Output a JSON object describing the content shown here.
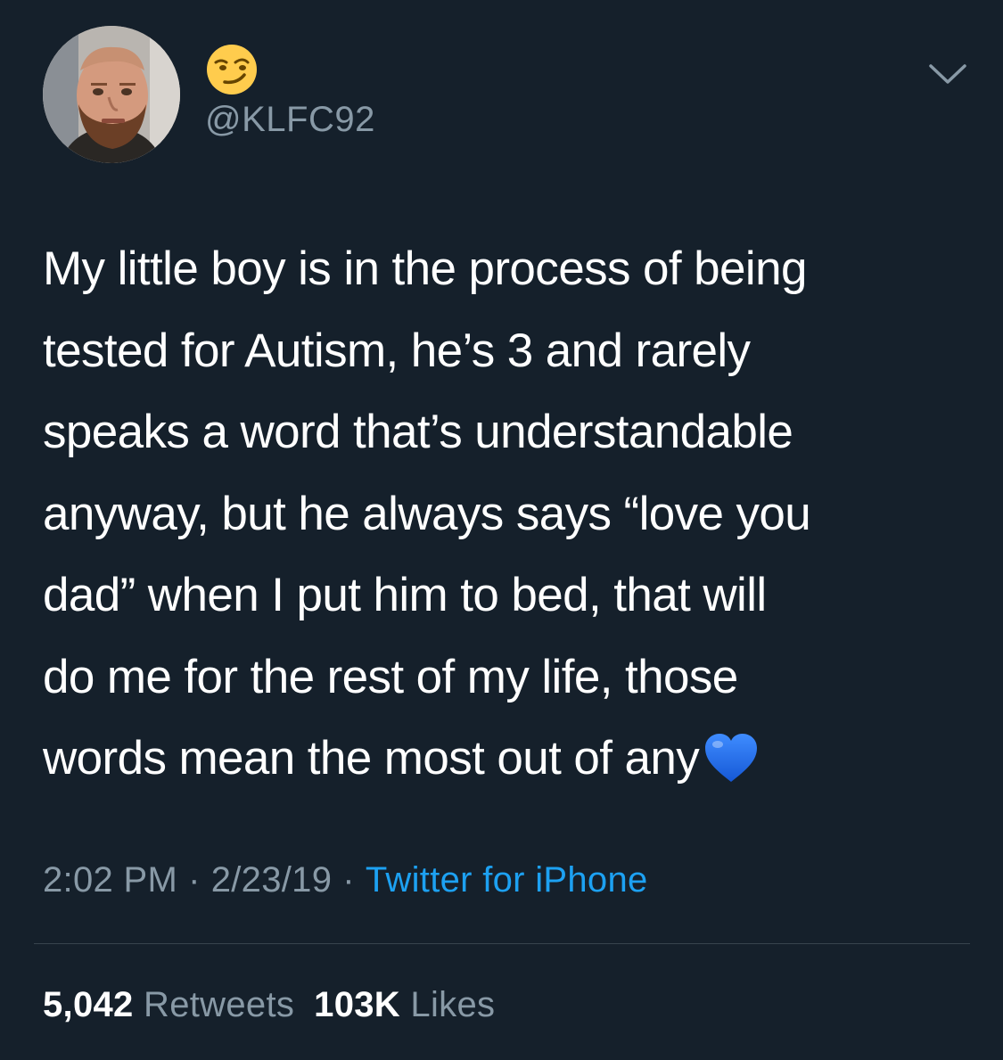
{
  "user": {
    "avatar_icon": "profile-photo-man-with-beard",
    "display_name_icon": "smirking-face-emoji",
    "handle": "@KLFC92"
  },
  "tweet": {
    "lines": [
      "My little boy is in the process of being",
      "tested for Autism, he’s 3 and rarely",
      "speaks a word that’s understandable",
      "anyway, but he always says “love you",
      "dad” when I put him to bed, that will",
      "do me for the rest of my life, those",
      "words mean the most out of any"
    ],
    "trailing_emoji": "blue-heart-emoji"
  },
  "meta": {
    "time": "2:02 PM",
    "separator": "·",
    "date": "2/23/19",
    "source": "Twitter for iPhone"
  },
  "stats": {
    "retweets_count": "5,042",
    "retweets_label": "Retweets",
    "likes_count": "103K",
    "likes_label": "Likes"
  },
  "colors": {
    "background": "#15202b",
    "text": "#ffffff",
    "secondary_text": "#8899a6",
    "link": "#1da1f2",
    "divider": "#38444d",
    "heart": "#1e6ff0"
  }
}
